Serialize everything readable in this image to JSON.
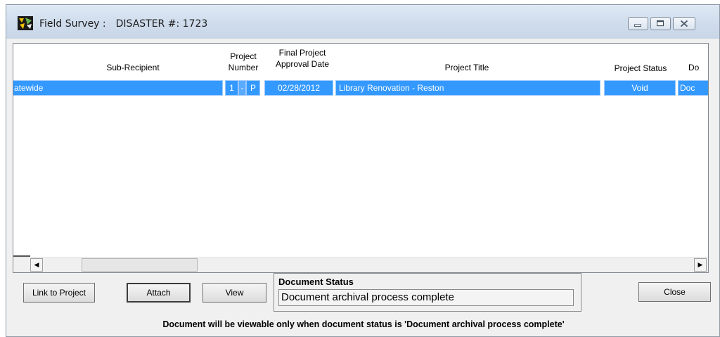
{
  "window": {
    "title_app": "Field Survey :",
    "title_disaster": "DISASTER #: 1723"
  },
  "grid": {
    "columns": [
      {
        "name": "sub_recipient",
        "label": "Sub-Recipient"
      },
      {
        "name": "project_number",
        "label_line1": "Project",
        "label_line2": "Number"
      },
      {
        "name": "approval_date",
        "label_line1": "Final Project",
        "label_line2": "Approval Date"
      },
      {
        "name": "project_title",
        "label": "Project Title"
      },
      {
        "name": "project_status",
        "label": "Project Status"
      },
      {
        "name": "doc",
        "label": "Do"
      }
    ],
    "rows": [
      {
        "sub_recipient": "atewide",
        "project_number": "1",
        "project_sep": "-",
        "project_cat": "P",
        "approval_date": "02/28/2012",
        "project_title": "Library Renovation - Reston",
        "project_status": "Void",
        "doc": "Doc",
        "selected": true
      }
    ]
  },
  "buttons": {
    "link": "Link to Project",
    "attach": "Attach",
    "view": "View",
    "close": "Close"
  },
  "document_status": {
    "label": "Document Status",
    "value": "Document archival process complete"
  },
  "footer_note": "Document will be viewable only when document status is 'Document archival process complete'",
  "icons": {
    "app": "field-survey-app-icon",
    "minimize": "minimize-icon",
    "maximize": "maximize-icon",
    "close": "close-icon",
    "scroll_left": "arrow-left-icon",
    "scroll_right": "arrow-right-icon"
  },
  "colors": {
    "selection": "#3399ff",
    "titlebar": "#cfdcec"
  }
}
